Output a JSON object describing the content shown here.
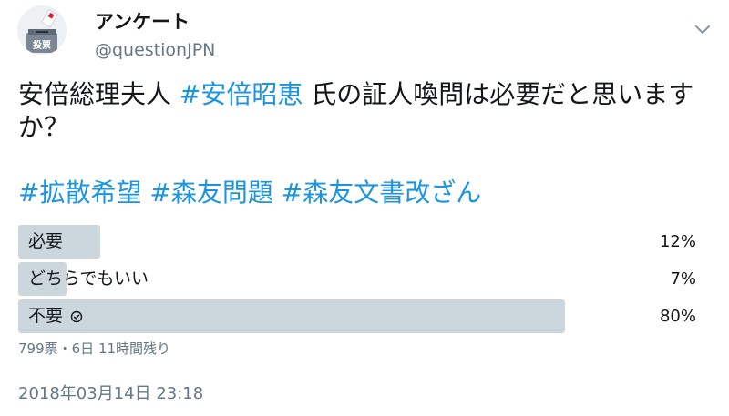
{
  "author": {
    "display_name": "アンケート",
    "handle": "@questionJPN",
    "avatar_text": "投票"
  },
  "tweet": {
    "text_prefix": "安倍総理夫人 ",
    "mention_tag": "#安倍昭恵",
    "text_suffix": " 氏の証人喚問は必要だと思いますか？",
    "hashtags": [
      "#拡散希望",
      "#森友問題",
      "#森友文書改ざん"
    ]
  },
  "poll": {
    "options": [
      {
        "label": "必要",
        "percent_text": "12%",
        "percent": 12,
        "winner": false
      },
      {
        "label": "どちらでもいい",
        "percent_text": "7%",
        "percent": 7,
        "winner": false
      },
      {
        "label": "不要",
        "percent_text": "80%",
        "percent": 80,
        "winner": true
      }
    ],
    "meta": "799票・6日 11時間残り"
  },
  "timestamp": "2018年03月14日 23:18",
  "colors": {
    "link": "#1b95e0",
    "bar": "#ccd6dd",
    "muted": "#657786",
    "text": "#14171a",
    "stamp_red": "#d8233a"
  }
}
